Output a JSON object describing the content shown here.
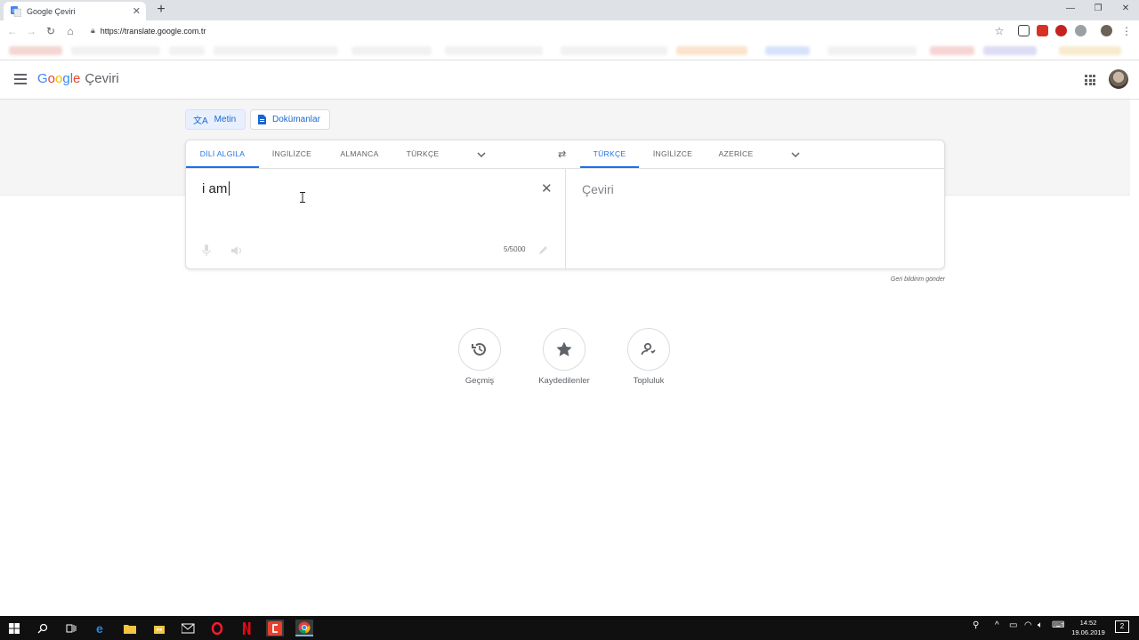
{
  "browser": {
    "tab_title": "Google Çeviri",
    "new_tab": "+",
    "url": "https://translate.google.com.tr"
  },
  "header": {
    "logo": "Google",
    "product": "Çeviri"
  },
  "modes": {
    "text_label": "Metin",
    "documents_label": "Dokümanlar"
  },
  "source_languages": [
    "DİLİ ALGILA",
    "İNGİLİZCE",
    "ALMANCA",
    "TÜRKÇE"
  ],
  "target_languages": [
    "TÜRKÇE",
    "İNGİLİZCE",
    "AZERİCE"
  ],
  "source": {
    "text": "i am",
    "char_count": "5/5000"
  },
  "target": {
    "placeholder": "Çeviri"
  },
  "feedback": "Geri bildirim gönder",
  "quick_actions": [
    "Geçmiş",
    "Kaydedilenler",
    "Topluluk"
  ],
  "taskbar": {
    "time": "14:52",
    "date": "19.06.2019",
    "notification_count": "2"
  },
  "colors": {
    "accent": "#1a73e8",
    "mode_active_bg": "#e8f0fe"
  }
}
